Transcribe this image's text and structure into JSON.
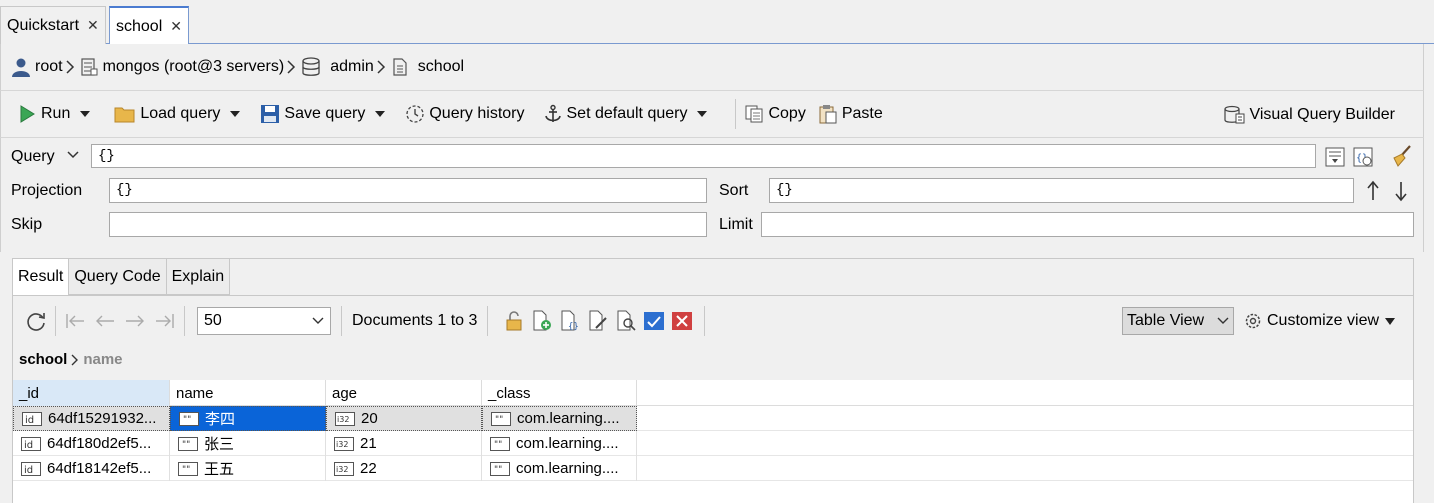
{
  "tabs": [
    {
      "label": "Quickstart",
      "active": false
    },
    {
      "label": "school",
      "active": true
    }
  ],
  "path": {
    "user": "root",
    "server": "mongos (root@3 servers)",
    "database": "admin",
    "collection": "school"
  },
  "toolbar": {
    "run": "Run",
    "load_query": "Load query",
    "save_query": "Save query",
    "query_history": "Query history",
    "set_default_query": "Set default query",
    "copy": "Copy",
    "paste": "Paste",
    "visual_query_builder": "Visual Query Builder"
  },
  "form": {
    "query_label": "Query",
    "query_value": "{}",
    "projection_label": "Projection",
    "projection_value": "{}",
    "sort_label": "Sort",
    "sort_value": "{}",
    "skip_label": "Skip",
    "skip_value": "",
    "limit_label": "Limit",
    "limit_value": ""
  },
  "result_tabs": [
    {
      "label": "Result",
      "active": true
    },
    {
      "label": "Query Code",
      "active": false
    },
    {
      "label": "Explain",
      "active": false
    }
  ],
  "result_toolbar": {
    "page_size": "50",
    "documents_label": "Documents 1 to 3",
    "view_mode": "Table View",
    "customize_view": "Customize view"
  },
  "result_breadcrumb": {
    "collection": "school",
    "field": "name"
  },
  "table": {
    "columns": [
      "_id",
      "name",
      "age",
      "_class"
    ],
    "rows": [
      {
        "id": "64df15291932...",
        "name": "李四",
        "age": "20",
        "class": "com.learning....",
        "selected": true
      },
      {
        "id": "64df180d2ef5...",
        "name": "张三",
        "age": "21",
        "class": "com.learning....",
        "selected": false
      },
      {
        "id": "64df18142ef5...",
        "name": "王五",
        "age": "22",
        "class": "com.learning....",
        "selected": false
      }
    ]
  },
  "colors": {
    "accent": "#0a64d8",
    "run_green": "#3aa655",
    "sorted_header": "#d9e8f7",
    "delete_red": "#d04040"
  }
}
